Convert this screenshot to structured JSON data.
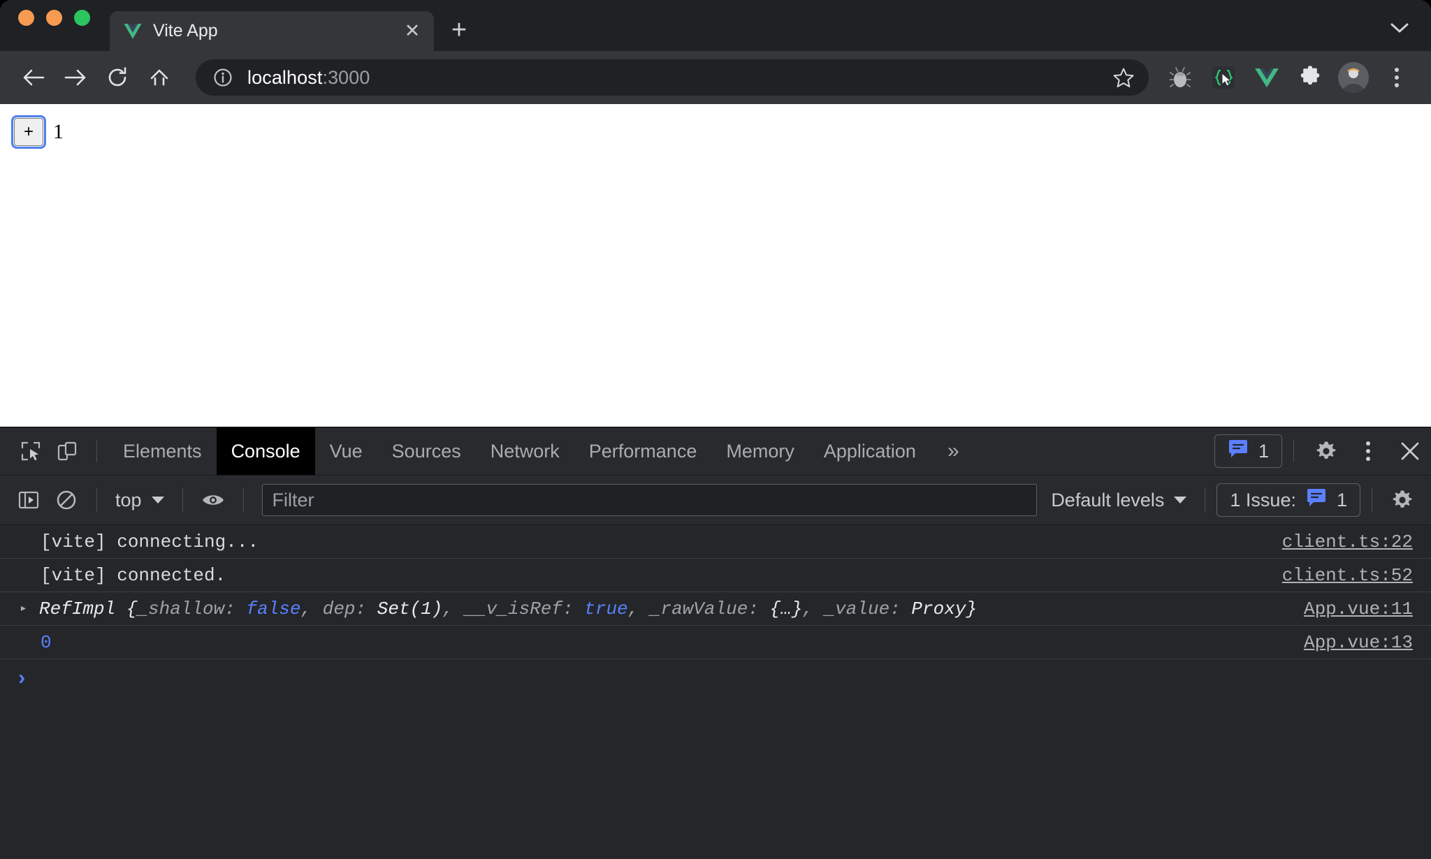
{
  "browser": {
    "traffic_lights": [
      "close",
      "minimize",
      "maximize"
    ],
    "tab": {
      "title": "Vite App",
      "favicon": "vue-logo-icon",
      "close_label": "✕"
    },
    "new_tab_label": "+",
    "tab_search_icon": "chevron-down-icon",
    "toolbar": {
      "back_icon": "arrow-left-icon",
      "forward_icon": "arrow-right-icon",
      "reload_icon": "reload-icon",
      "home_icon": "home-icon",
      "omnibox": {
        "info_icon": "info-circle-icon",
        "url_host": "localhost",
        "url_port": ":3000",
        "full_url": "localhost:3000",
        "star_icon": "star-icon"
      },
      "extensions": [
        {
          "name": "bug-extension-icon"
        },
        {
          "name": "code-cursor-extension-icon"
        },
        {
          "name": "vue-devtools-extension-icon"
        },
        {
          "name": "puzzle-extensions-icon"
        }
      ],
      "avatar_icon": "profile-avatar",
      "menu_icon": "three-dot-menu-icon"
    }
  },
  "page": {
    "increment_button_label": "+",
    "count_value": "1"
  },
  "devtools": {
    "inspect_icon": "inspect-element-icon",
    "device_toolbar_icon": "device-toolbar-icon",
    "tabs": [
      {
        "label": "Elements",
        "active": false
      },
      {
        "label": "Console",
        "active": true
      },
      {
        "label": "Vue",
        "active": false
      },
      {
        "label": "Sources",
        "active": false
      },
      {
        "label": "Network",
        "active": false
      },
      {
        "label": "Performance",
        "active": false
      },
      {
        "label": "Memory",
        "active": false
      },
      {
        "label": "Application",
        "active": false
      }
    ],
    "more_tabs_label": "»",
    "issues_badge": {
      "icon": "message-issue-icon",
      "count": "1"
    },
    "settings_icon": "gear-icon",
    "more_options_icon": "three-dot-menu-icon",
    "close_icon": "close-icon",
    "filterbar": {
      "sidebar_toggle_icon": "console-sidebar-icon",
      "clear_console_icon": "clear-console-icon",
      "context_label": "top",
      "live_expression_icon": "eye-icon",
      "filter_placeholder": "Filter",
      "filter_value": "",
      "levels_label": "Default levels",
      "issue_label": "1 Issue:",
      "issue_count": "1",
      "issue_icon": "message-issue-icon",
      "settings_icon": "gear-icon"
    },
    "console": {
      "messages": [
        {
          "kind": "plain",
          "text": "[vite] connecting...",
          "source": "client.ts:22",
          "expandable": false
        },
        {
          "kind": "plain",
          "text": "[vite] connected.",
          "source": "client.ts:52",
          "expandable": false
        },
        {
          "kind": "object",
          "expandable": true,
          "arrow": "▸",
          "constructor": "RefImpl",
          "open_brace": " {",
          "close_brace": "}",
          "properties": [
            {
              "key": "_shallow",
              "value": "false",
              "type": "bool"
            },
            {
              "key": "dep",
              "value": "Set(1)",
              "type": "val"
            },
            {
              "key": "__v_isRef",
              "value": "true",
              "type": "bool"
            },
            {
              "key": "_rawValue",
              "value": "{…}",
              "type": "val"
            },
            {
              "key": "_value",
              "value": "Proxy",
              "type": "val"
            }
          ],
          "text": "RefImpl {_shallow: false, dep: Set(1), __v_isRef: true, _rawValue: {…}, _value: Proxy}",
          "source": "App.vue:11"
        },
        {
          "kind": "number",
          "text": "0",
          "source": "App.vue:13",
          "expandable": false
        }
      ],
      "prompt_caret": "›"
    }
  },
  "colors": {
    "browser_chrome": "#202124",
    "toolbar": "#35363A",
    "devtools_bg": "#242629",
    "devtools_panel": "#292A2D",
    "accent_blue": "#5B7FFF",
    "vue_green": "#42B883",
    "focus_ring": "#4D7FEF",
    "traffic_orange": "#F79A52",
    "traffic_green": "#2CC45F"
  }
}
